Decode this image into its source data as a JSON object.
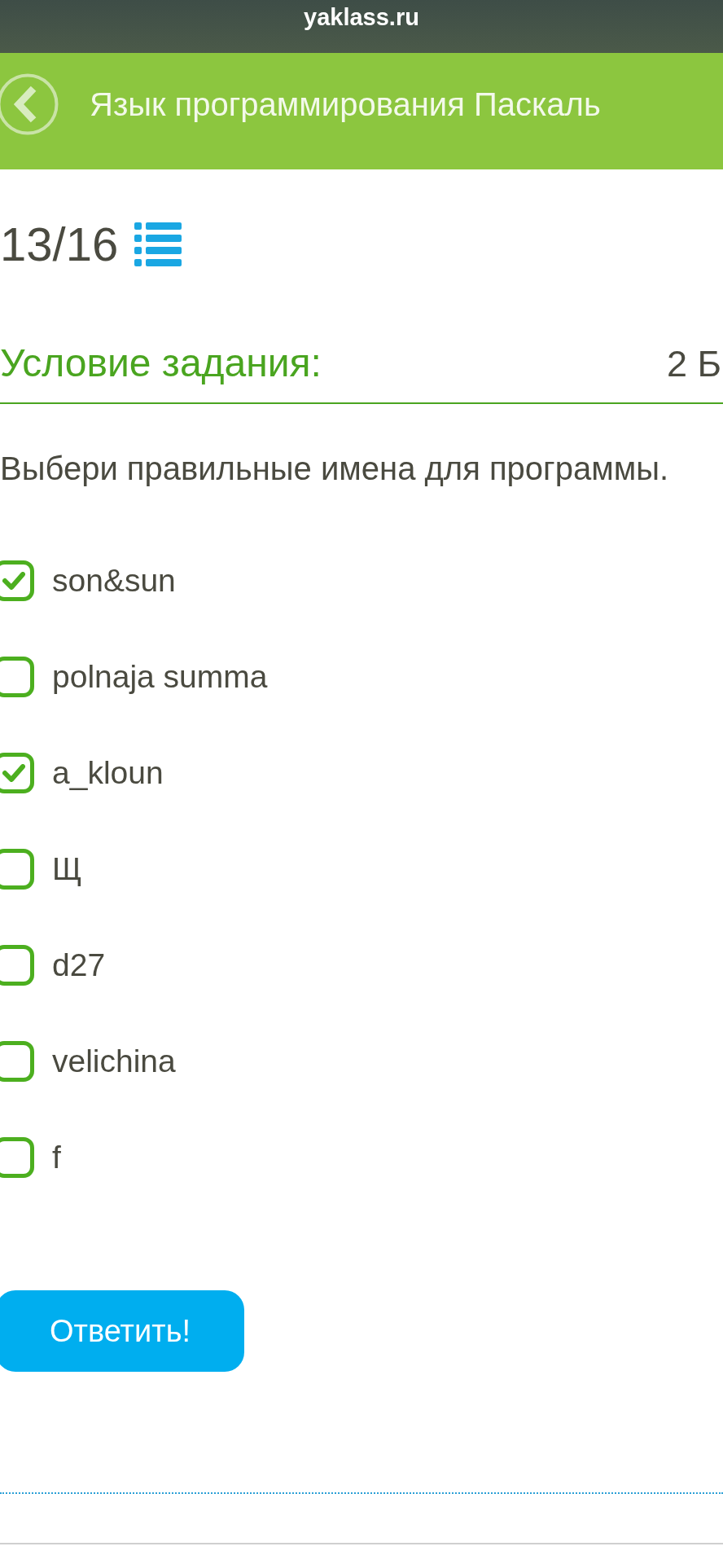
{
  "browser_bar": {
    "url": "yaklass.ru"
  },
  "header": {
    "title": "Язык программирования Паскаль"
  },
  "progress": {
    "counter": "13/16"
  },
  "task": {
    "heading": "Условие задания:",
    "points": "2 Б",
    "prompt": "Выбери правильные имена для программы.",
    "options": [
      {
        "label": "son&sun",
        "checked": true
      },
      {
        "label": "polnaja summa",
        "checked": false
      },
      {
        "label": "a_kloun",
        "checked": true
      },
      {
        "label": "Щ",
        "checked": false
      },
      {
        "label": "d27",
        "checked": false
      },
      {
        "label": "velichina",
        "checked": false
      },
      {
        "label": "f",
        "checked": false
      }
    ]
  },
  "submit_button": {
    "label": "Ответить!"
  }
}
